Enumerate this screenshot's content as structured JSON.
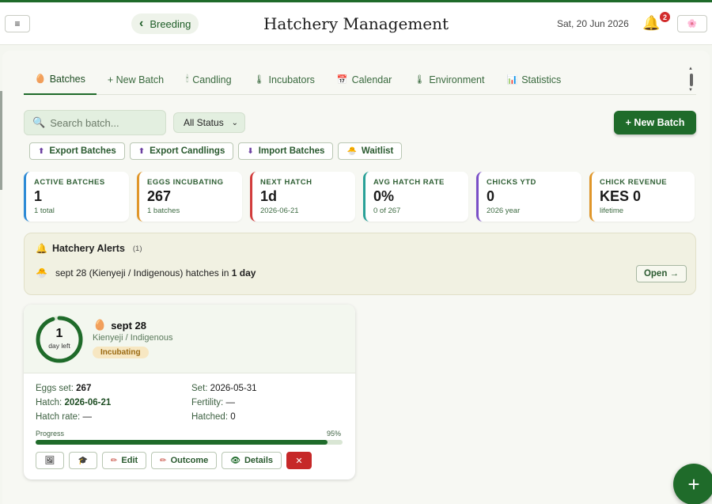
{
  "header": {
    "menu_icon": "≡",
    "back_label": "Breeding",
    "title": "Hatchery Management",
    "date": "Sat, 20 Jun 2026",
    "notification_count": "2",
    "lang_flag": "🌸"
  },
  "tabs": [
    {
      "label": "Batches",
      "icon": "🥚"
    },
    {
      "label": "+ New Batch",
      "icon": ""
    },
    {
      "label": "Candling",
      "icon": "🕯"
    },
    {
      "label": "Incubators",
      "icon": "🌡"
    },
    {
      "label": "Calendar",
      "icon": "📅"
    },
    {
      "label": "Environment",
      "icon": "🌡"
    },
    {
      "label": "Statistics",
      "icon": "📊"
    }
  ],
  "toolbar": {
    "search_placeholder": "Search batch...",
    "status_value": "All Status",
    "new_batch_label": "+ New Batch",
    "actions": [
      {
        "label": "Export Batches"
      },
      {
        "label": "Export Candlings"
      },
      {
        "label": "Import Batches"
      },
      {
        "label": "Waitlist"
      }
    ]
  },
  "stats": [
    {
      "label": "ACTIVE BATCHES",
      "value": "1",
      "sub": "1 total",
      "color": "#2e8bd6"
    },
    {
      "label": "EGGS INCUBATING",
      "value": "267",
      "sub": "1 batches",
      "color": "#e0962a"
    },
    {
      "label": "NEXT HATCH",
      "value": "1d",
      "sub": "2026-06-21",
      "color": "#d23c3c"
    },
    {
      "label": "AVG HATCH RATE",
      "value": "0%",
      "sub": "0 of 267",
      "color": "#2aa198"
    },
    {
      "label": "CHICKS YTD",
      "value": "0",
      "sub": "2026 year",
      "color": "#7a4fc7"
    },
    {
      "label": "CHICK REVENUE",
      "value": "KES 0",
      "sub": "lifetime",
      "color": "#e0962a"
    }
  ],
  "alerts": {
    "title": "Hatchery Alerts",
    "count": "(1)",
    "item_text": "sept 28 (Kienyeji / Indigenous) hatches in",
    "item_emph": "1 day",
    "open_label": "Open →"
  },
  "batch": {
    "days_left": "1",
    "days_left_label": "day left",
    "name": "sept 28",
    "breed": "Kienyeji / Indigenous",
    "status": "Incubating",
    "eggs_set_label": "Eggs set:",
    "eggs_set": "267",
    "set_label": "Set:",
    "set_date": "2026-05-31",
    "hatch_label": "Hatch:",
    "hatch_date": "2026-06-21",
    "fertility_label": "Fertility:",
    "fertility": "—",
    "hatch_rate_label": "Hatch rate:",
    "hatch_rate": "—",
    "hatched_label": "Hatched:",
    "hatched": "0",
    "progress_label": "Progress",
    "progress_pct": "95%",
    "progress_value": 0.95,
    "edit_label": "Edit",
    "outcome_label": "Outcome",
    "details_label": "Details",
    "delete_label": "✕"
  },
  "fab_label": "+"
}
